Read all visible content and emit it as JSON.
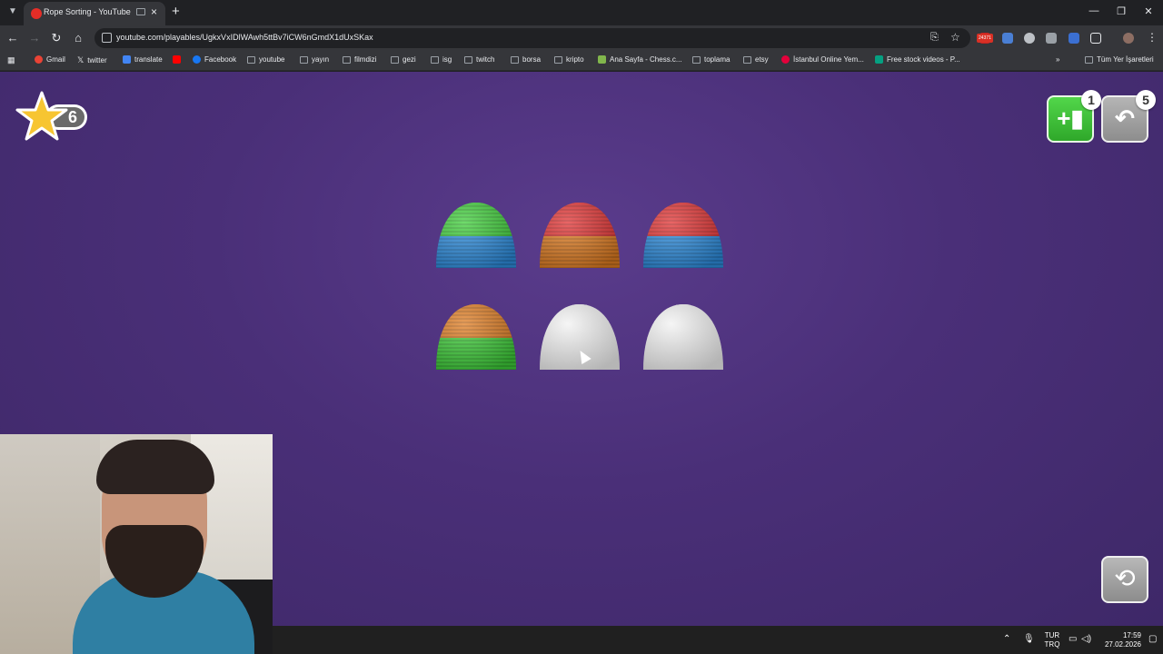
{
  "browser": {
    "tab_title": "Rope Sorting - YouTube",
    "new_tab": "+",
    "url": "youtube.com/playables/UgkxVxIDlWAwh5ttBv7iCW6nGmdX1dUxSKax",
    "extension_badge": "24371",
    "window_controls": {
      "minimize": "—",
      "restore": "❐",
      "close": "✕"
    },
    "nav": {
      "back": "←",
      "forward": "→",
      "reload": "↻",
      "home": "⌂"
    }
  },
  "bookmarks": {
    "items": [
      {
        "label": "Gmail",
        "icon": "gmail-icon",
        "color": "#ea4335"
      },
      {
        "label": "twitter",
        "icon": "x-icon",
        "color": "#000000"
      },
      {
        "label": "translate",
        "icon": "translate-icon",
        "color": "#4285f4"
      },
      {
        "label": "",
        "icon": "youtube-icon",
        "color": "#ff0000"
      },
      {
        "label": "Facebook",
        "icon": "facebook-icon",
        "color": "#1877f2"
      },
      {
        "label": "youtube",
        "icon": "folder-icon"
      },
      {
        "label": "yayın",
        "icon": "folder-icon"
      },
      {
        "label": "filmdizi",
        "icon": "folder-icon"
      },
      {
        "label": "gezi",
        "icon": "folder-icon"
      },
      {
        "label": "isg",
        "icon": "folder-icon"
      },
      {
        "label": "twitch",
        "icon": "folder-icon"
      },
      {
        "label": "borsa",
        "icon": "folder-icon"
      },
      {
        "label": "kripto",
        "icon": "folder-icon"
      },
      {
        "label": "Ana Sayfa - Chess.c...",
        "icon": "chess-icon",
        "color": "#81b64c"
      },
      {
        "label": "toplama",
        "icon": "folder-icon"
      },
      {
        "label": "etsy",
        "icon": "folder-icon"
      },
      {
        "label": "İstanbul Online Yem...",
        "icon": "yemeksepeti-icon",
        "color": "#e4003b"
      },
      {
        "label": "Free stock videos - P...",
        "icon": "pexels-icon",
        "color": "#05a081"
      }
    ],
    "overflow": "»",
    "all_bookmarks": "Tüm Yer İşaretleri"
  },
  "game": {
    "stars": "6",
    "add_spool_count": "1",
    "undo_count": "5",
    "spools": [
      {
        "layers": [
          "#2f8fe0",
          "#2f8fe0",
          "#3fcf3a",
          "#3fcf3a"
        ]
      },
      {
        "layers": [
          "#e07d22",
          "#e07d22",
          "#e23232",
          "#e23232"
        ]
      },
      {
        "layers": [
          "#2f8fe0",
          "#2f8fe0",
          "#e23232",
          "#e23232"
        ]
      },
      {
        "layers": [
          "#3fcf3a",
          "#3fcf3a",
          "#e07d22",
          "#e07d22"
        ]
      },
      {
        "layers": [
          "#f2f2f2",
          "#f2f2f2",
          "#f2f2f2",
          "#f2f2f2"
        ]
      },
      {
        "layers": [
          "#f2f2f2",
          "#f2f2f2",
          "#f2f2f2",
          "#f2f2f2"
        ]
      }
    ]
  },
  "taskbar": {
    "lang_top": "TUR",
    "lang_bottom": "TRQ",
    "time": "17:59",
    "date": "27.02.2026"
  }
}
